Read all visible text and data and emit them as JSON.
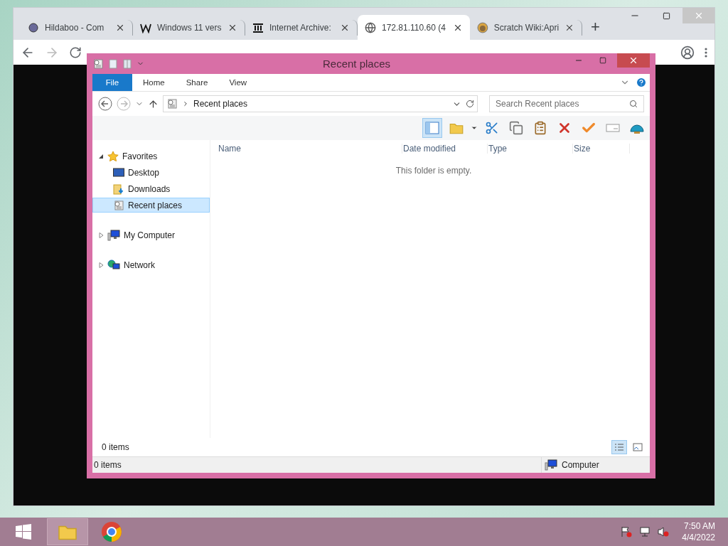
{
  "browser": {
    "tabs": [
      {
        "title": "Hildaboo - Com",
        "selected": false
      },
      {
        "title": "Windows 11 vers",
        "selected": false
      },
      {
        "title": "Internet Archive:",
        "selected": false
      },
      {
        "title": "172.81.110.60 (4",
        "selected": true
      },
      {
        "title": "Scratch Wiki:Apri",
        "selected": false
      }
    ],
    "new_tab": "+"
  },
  "explorer": {
    "title": "Recent places",
    "ribbon_tabs": [
      {
        "label": "File",
        "kind": "file"
      },
      {
        "label": "Home",
        "kind": "tab"
      },
      {
        "label": "Share",
        "kind": "tab"
      },
      {
        "label": "View",
        "kind": "tab"
      }
    ],
    "address": "Recent places",
    "search": {
      "placeholder": "Search Recent places"
    },
    "nav": [
      {
        "label": "Favorites",
        "expanded": true,
        "selected": false,
        "children": [
          {
            "label": "Desktop",
            "selected": false
          },
          {
            "label": "Downloads",
            "selected": false
          },
          {
            "label": "Recent places",
            "selected": true
          }
        ]
      },
      {
        "label": "My Computer",
        "expanded": false,
        "selected": false
      },
      {
        "label": "Network",
        "expanded": false,
        "selected": false
      }
    ],
    "columns": [
      "Name",
      "Date modified",
      "Type",
      "Size"
    ],
    "empty_message": "This folder is empty.",
    "item_count": "0 items",
    "status_bar": {
      "items": "0 items",
      "location": "Computer"
    }
  },
  "taskbar": {
    "time": "7:50 AM",
    "date": "4/4/2022"
  }
}
